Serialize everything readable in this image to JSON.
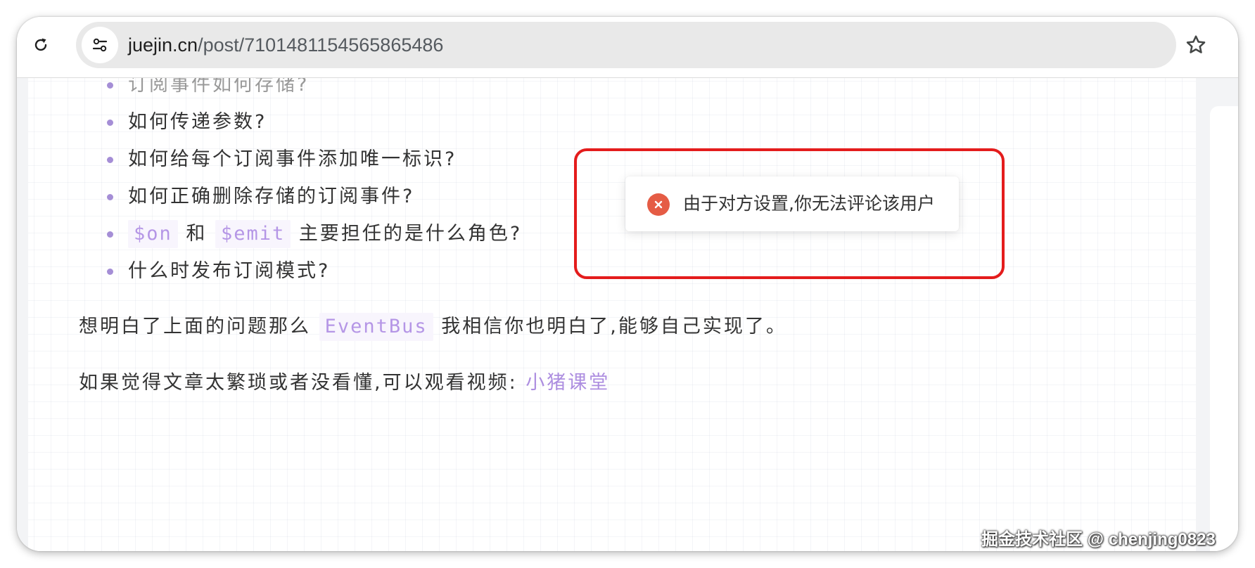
{
  "browser": {
    "url_host": "juejin.cn",
    "url_path": "/post/7101481154565865486",
    "icons": {
      "reload": "reload-icon",
      "site_info": "tune-icon",
      "bookmark": "star-icon"
    }
  },
  "article": {
    "list_items": [
      {
        "text": "订阅事件如何存储?"
      },
      {
        "text": "如何传递参数?"
      },
      {
        "text": "如何给每个订阅事件添加唯一标识?"
      },
      {
        "text": "如何正确删除存储的订阅事件?"
      },
      {
        "code1": "$on",
        "mid": "和",
        "code2": "$emit",
        "text": "主要担任的是什么角色?"
      },
      {
        "text": "什么时发布订阅模式?"
      }
    ],
    "para1": {
      "before": "想明白了上面的问题那么",
      "code": "EventBus",
      "after": "我相信你也明白了,能够自己实现了。"
    },
    "para2": {
      "text": "如果觉得文章太繁琐或者没看懂,可以观看视频:",
      "link": "小猪课堂"
    }
  },
  "toast": {
    "message": "由于对方设置,你无法评论该用户",
    "icon": "error-icon",
    "icon_color": "#e55c45"
  },
  "colors": {
    "highlight_border": "#e41c1c",
    "accent": "#ad8ee0"
  },
  "watermark": "掘金技术社区 @ chenjing0823"
}
